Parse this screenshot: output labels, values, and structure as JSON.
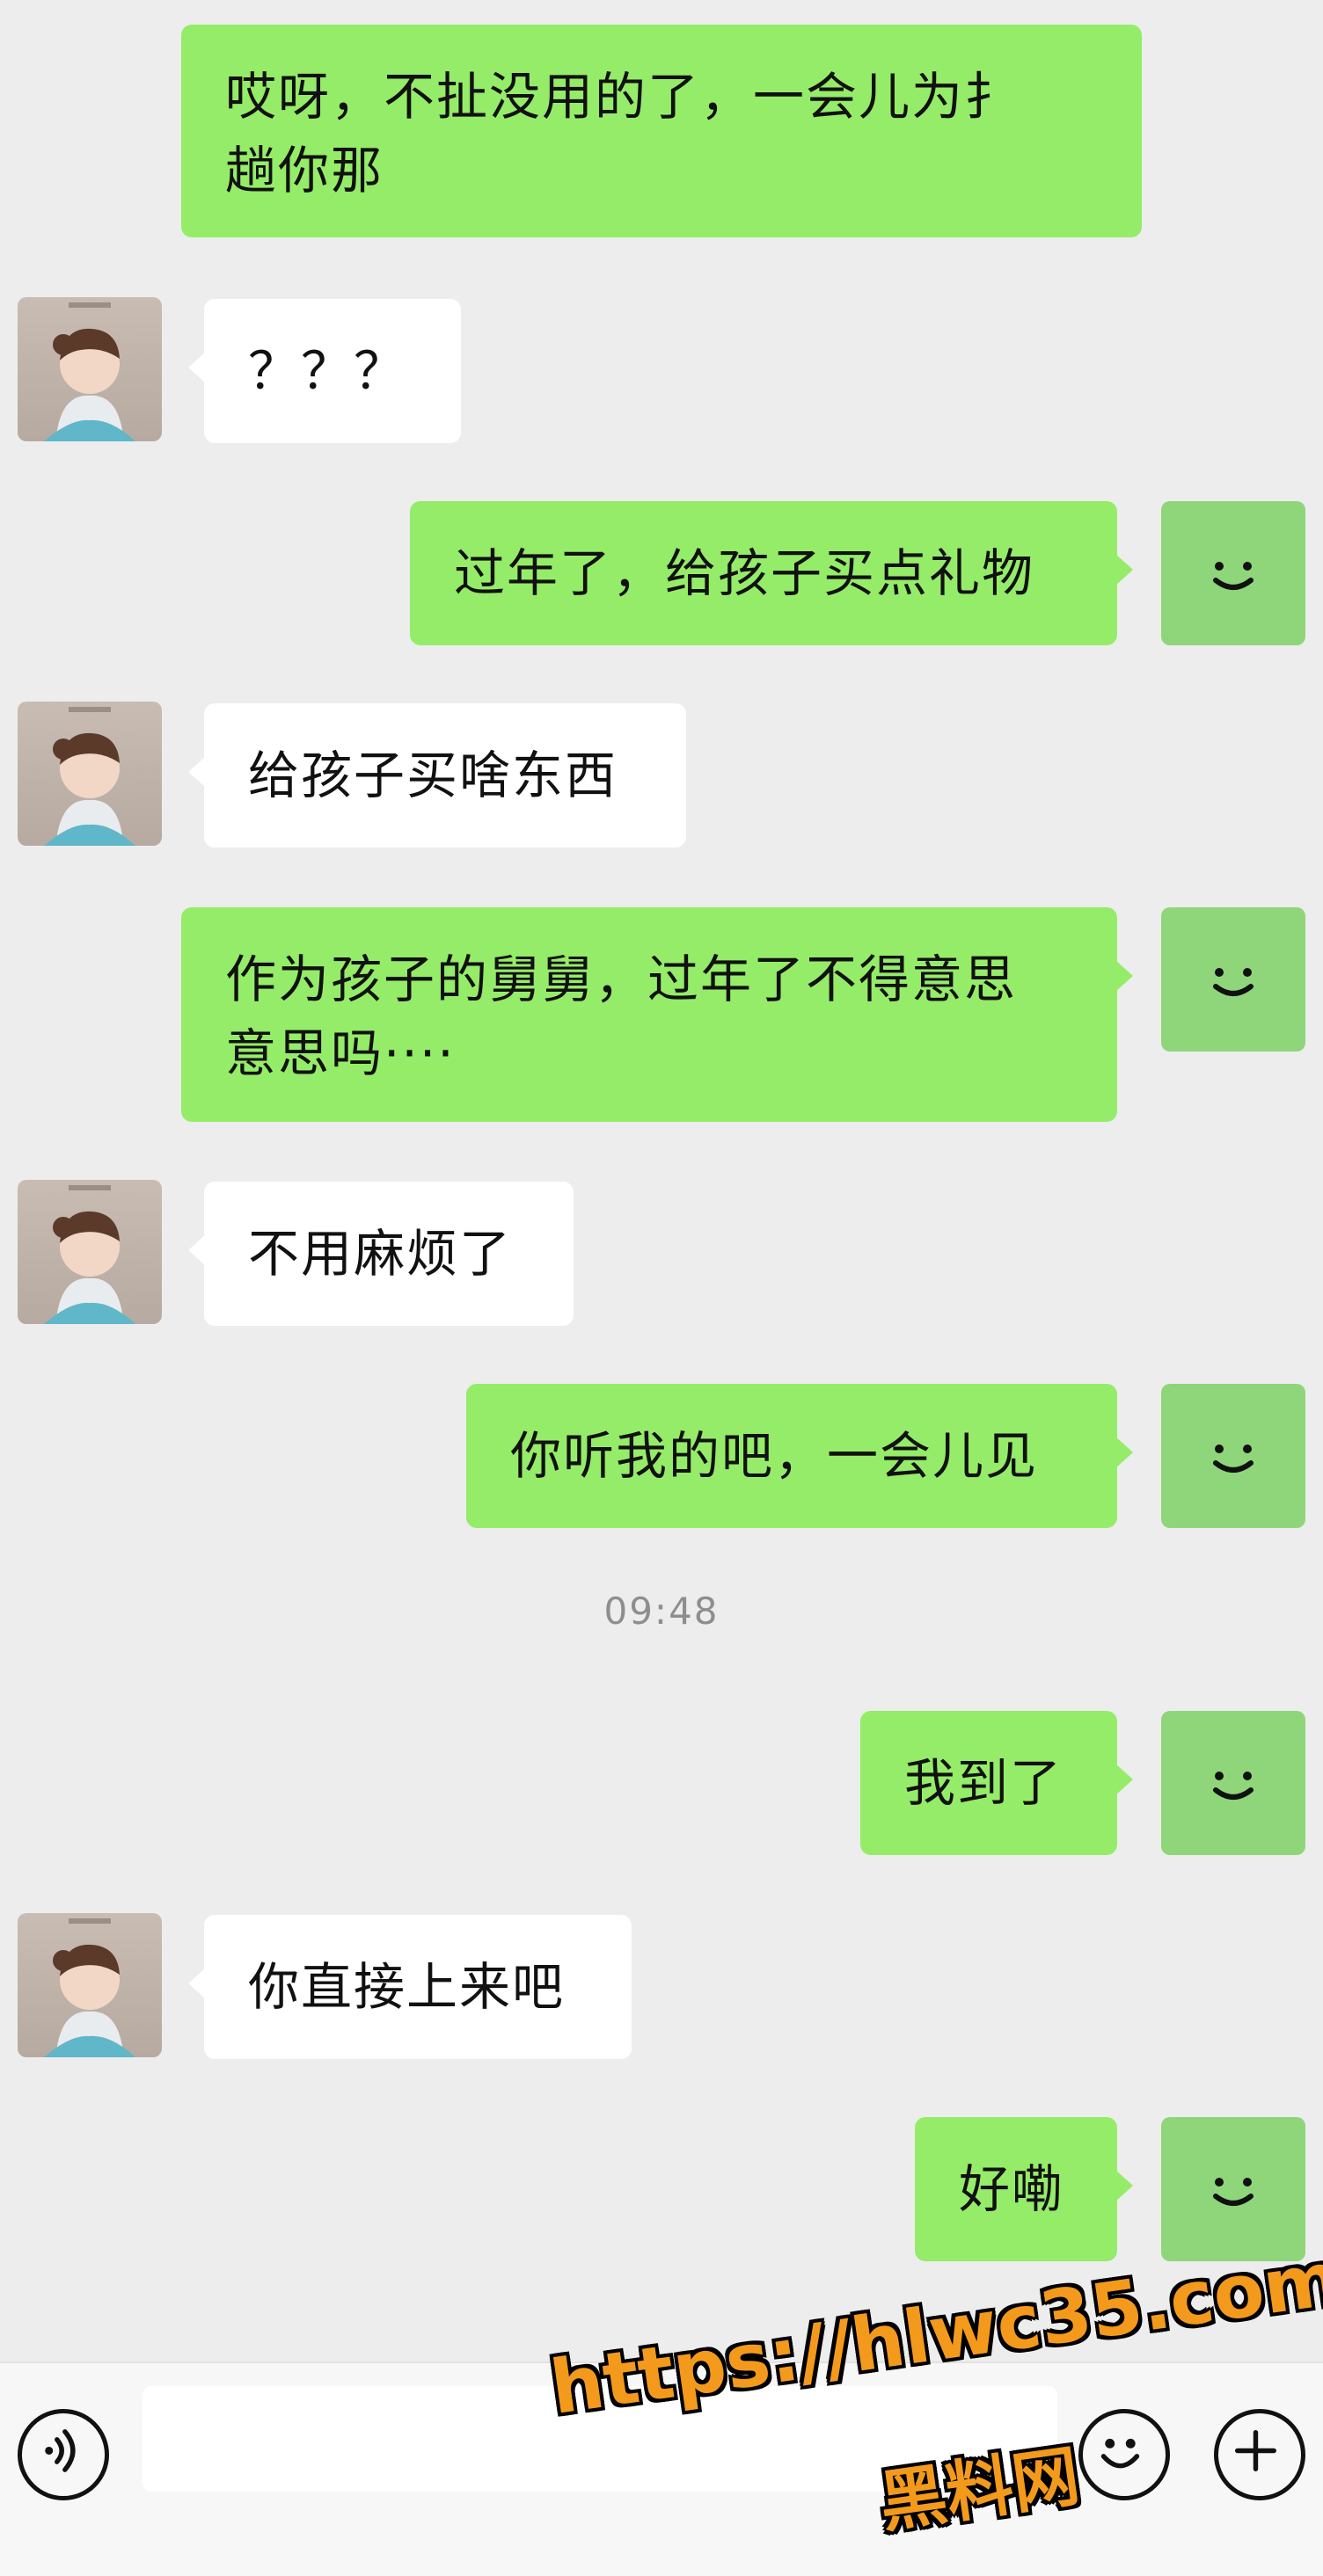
{
  "messages": [
    {
      "side": "me",
      "text": "哎呀，不扯没用的了，一会儿为扌\n趟你那"
    },
    {
      "side": "peer",
      "text": "？？？"
    },
    {
      "side": "me",
      "text": "过年了，给孩子买点礼物"
    },
    {
      "side": "peer",
      "text": "给孩子买啥东西"
    },
    {
      "side": "me",
      "text": "作为孩子的舅舅，过年了不得意思\n意思吗····"
    },
    {
      "side": "peer",
      "text": "不用麻烦了"
    },
    {
      "side": "me",
      "text": "你听我的吧，一会儿见"
    },
    {
      "side": "me",
      "text": "我到了"
    },
    {
      "side": "peer",
      "text": "你直接上来吧"
    },
    {
      "side": "me",
      "text": "好嘞"
    }
  ],
  "timestamp": "09:48",
  "icons": {
    "peer_avatar": "cartoon-girl-avatar-icon",
    "self_avatar": "smile-face-avatar-icon",
    "voice": "voice-icon",
    "emoji": "emoji-icon",
    "plus": "plus-icon"
  },
  "colors": {
    "background": "#ededed",
    "sent_bubble": "#95ec69",
    "received_bubble": "#ffffff",
    "self_avatar": "#8fd67a",
    "watermark": "#f39a1d"
  },
  "watermark": {
    "url": "https://hlwc35.com",
    "name": "黑料网"
  }
}
